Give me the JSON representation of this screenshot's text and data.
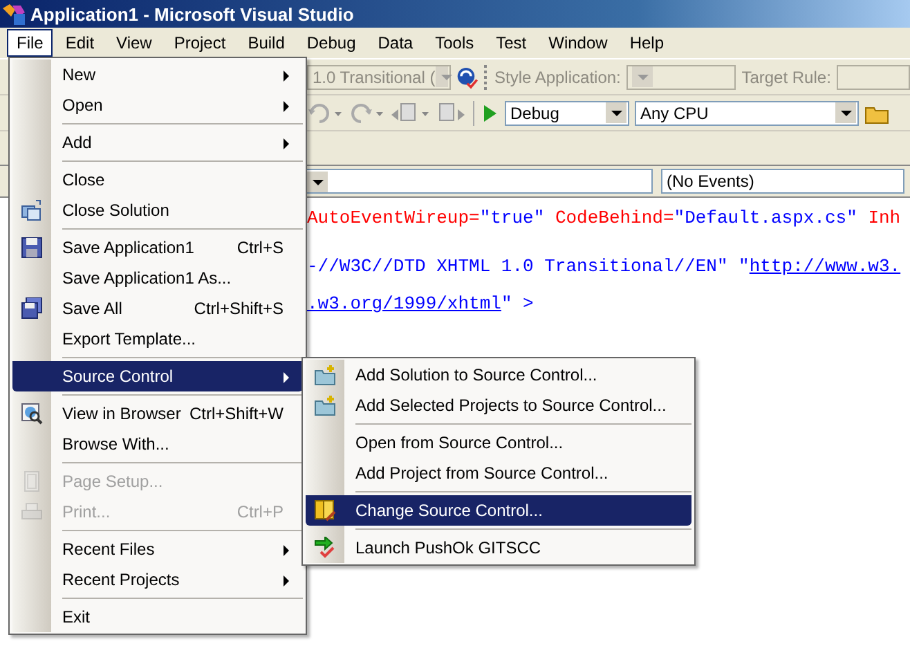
{
  "window": {
    "title": "Application1 - Microsoft Visual Studio"
  },
  "menu_bar": [
    {
      "label": "File",
      "selected": true
    },
    {
      "label": "Edit",
      "selected": false
    },
    {
      "label": "View",
      "selected": false
    },
    {
      "label": "Project",
      "selected": false
    },
    {
      "label": "Build",
      "selected": false
    },
    {
      "label": "Debug",
      "selected": false
    },
    {
      "label": "Data",
      "selected": false
    },
    {
      "label": "Tools",
      "selected": false
    },
    {
      "label": "Test",
      "selected": false
    },
    {
      "label": "Window",
      "selected": false
    },
    {
      "label": "Help",
      "selected": false
    }
  ],
  "toolbar": {
    "doctype_combo": "1.0 Transitional (",
    "style_application_label": "Style Application:",
    "target_rule_label": "Target Rule:",
    "configuration_combo": "Debug",
    "platform_combo": "Any CPU"
  },
  "editor": {
    "member_combo": "(No Events)",
    "lines": [
      [
        {
          "text": "AutoEventWireup=",
          "kind": "attr"
        },
        {
          "text": "\"true\"",
          "kind": "value"
        },
        {
          "text": " CodeBehind=",
          "kind": "attr"
        },
        {
          "text": "\"Default.aspx.cs\"",
          "kind": "value"
        },
        {
          "text": " Inh",
          "kind": "attr"
        }
      ],
      [
        {
          "text": "-//W3C//DTD XHTML 1.0 Transitional//EN\" \"",
          "kind": "value"
        },
        {
          "text": "http://www.w3.",
          "kind": "link"
        }
      ],
      [
        {
          "text": ".w3.org/1999/xhtml",
          "kind": "link"
        },
        {
          "text": "\" >",
          "kind": "value"
        }
      ]
    ]
  },
  "file_menu": [
    {
      "label": "New",
      "submenu": true,
      "separator_before": false,
      "disabled": false,
      "selected": false
    },
    {
      "label": "Open",
      "submenu": true,
      "separator_before": false,
      "disabled": false,
      "selected": false
    },
    {
      "label": "Add",
      "submenu": true,
      "separator_before": true,
      "disabled": false,
      "selected": false
    },
    {
      "label": "Close",
      "separator_before": true,
      "disabled": false,
      "selected": false
    },
    {
      "label": "Close Solution",
      "separator_before": false,
      "disabled": false,
      "selected": false
    },
    {
      "label": "Save Application1",
      "shortcut": "Ctrl+S",
      "separator_before": true,
      "disabled": false,
      "selected": false
    },
    {
      "label": "Save Application1 As...",
      "separator_before": false,
      "disabled": false,
      "selected": false
    },
    {
      "label": "Save All",
      "shortcut": "Ctrl+Shift+S",
      "separator_before": false,
      "disabled": false,
      "selected": false
    },
    {
      "label": "Export Template...",
      "separator_before": false,
      "disabled": false,
      "selected": false
    },
    {
      "label": "Source Control",
      "submenu": true,
      "separator_before": true,
      "disabled": false,
      "selected": true
    },
    {
      "label": "View in Browser",
      "shortcut": "Ctrl+Shift+W",
      "separator_before": true,
      "disabled": false,
      "selected": false
    },
    {
      "label": "Browse With...",
      "separator_before": false,
      "disabled": false,
      "selected": false
    },
    {
      "label": "Page Setup...",
      "separator_before": true,
      "disabled": true,
      "selected": false
    },
    {
      "label": "Print...",
      "shortcut": "Ctrl+P",
      "separator_before": false,
      "disabled": true,
      "selected": false
    },
    {
      "label": "Recent Files",
      "submenu": true,
      "separator_before": true,
      "disabled": false,
      "selected": false
    },
    {
      "label": "Recent Projects",
      "submenu": true,
      "separator_before": false,
      "disabled": false,
      "selected": false
    },
    {
      "label": "Exit",
      "separator_before": true,
      "disabled": false,
      "selected": false
    }
  ],
  "source_control_menu": [
    {
      "label": "Add Solution to Source Control...",
      "separator_before": false,
      "selected": false
    },
    {
      "label": "Add Selected Projects to Source Control...",
      "separator_before": false,
      "selected": false
    },
    {
      "label": "Open from Source Control...",
      "separator_before": true,
      "selected": false
    },
    {
      "label": "Add Project from Source Control...",
      "separator_before": false,
      "selected": false
    },
    {
      "label": "Change Source Control...",
      "separator_before": true,
      "selected": true
    },
    {
      "label": "Launch PushOk GITSCC",
      "separator_before": true,
      "selected": false
    }
  ]
}
